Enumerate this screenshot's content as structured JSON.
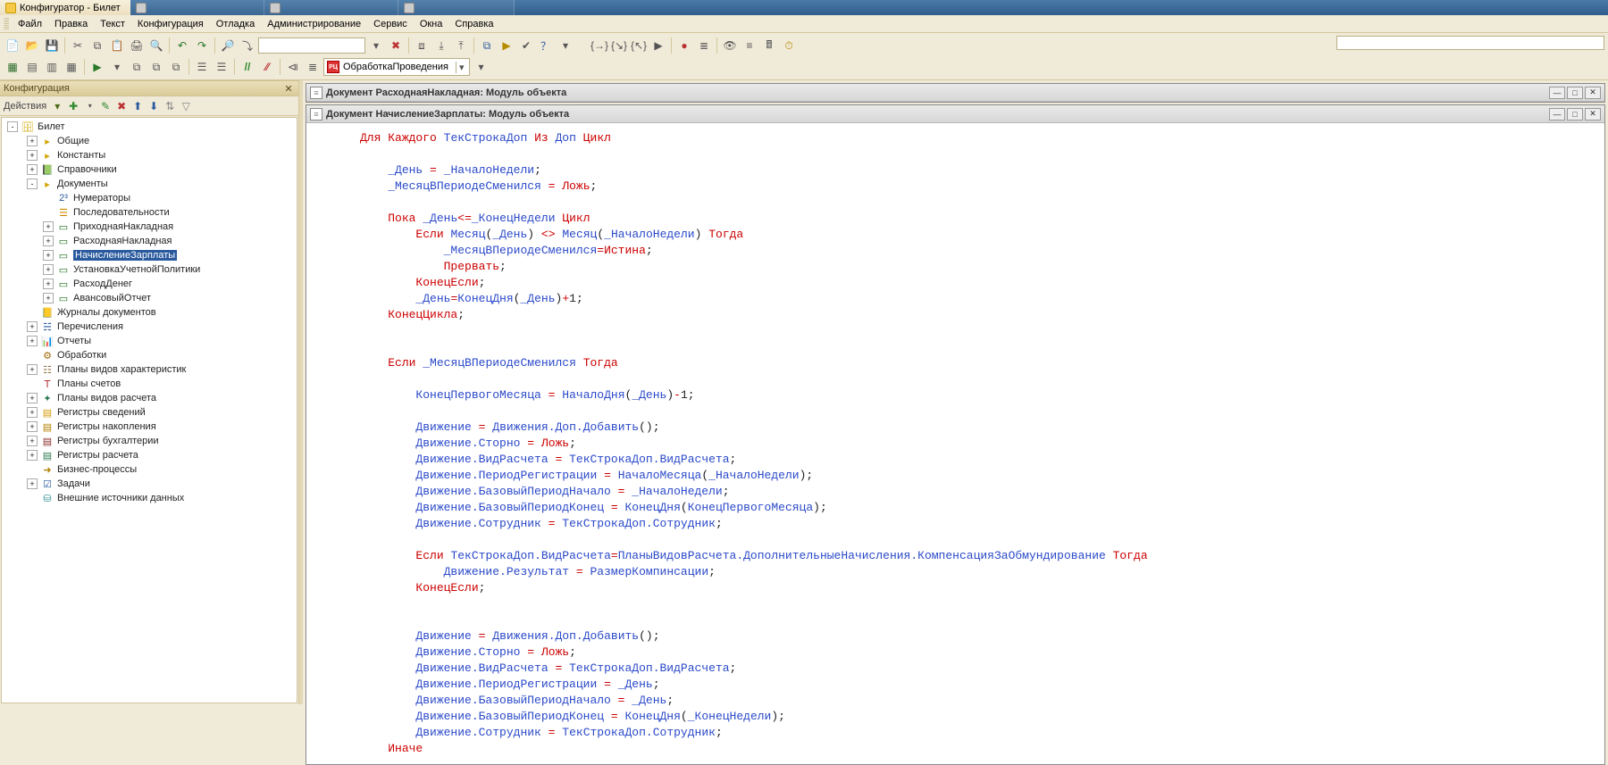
{
  "os_tabs": [
    {
      "label": "Конфигуратор - Билет",
      "active": true
    },
    {
      "label": "",
      "active": false
    },
    {
      "label": "",
      "active": false
    },
    {
      "label": "",
      "active": false
    }
  ],
  "menu": [
    "Файл",
    "Правка",
    "Текст",
    "Конфигурация",
    "Отладка",
    "Администрирование",
    "Сервис",
    "Окна",
    "Справка"
  ],
  "module_select": "ОбработкаПроведения",
  "panel_title": "Конфигурация",
  "panel_actions_label": "Действия",
  "tree": [
    {
      "lvl": 0,
      "exp": "-",
      "ico": "db",
      "label": "Билет",
      "sel": false
    },
    {
      "lvl": 1,
      "exp": "+",
      "ico": "folder",
      "label": "Общие"
    },
    {
      "lvl": 1,
      "exp": "+",
      "ico": "folder",
      "label": "Константы"
    },
    {
      "lvl": 1,
      "exp": "+",
      "ico": "book",
      "label": "Справочники"
    },
    {
      "lvl": 1,
      "exp": "-",
      "ico": "folder",
      "label": "Документы"
    },
    {
      "lvl": 2,
      "exp": " ",
      "ico": "num",
      "label": "Нумераторы"
    },
    {
      "lvl": 2,
      "exp": " ",
      "ico": "seq",
      "label": "Последовательности"
    },
    {
      "lvl": 2,
      "exp": "+",
      "ico": "doc",
      "label": "ПриходнаяНакладная"
    },
    {
      "lvl": 2,
      "exp": "+",
      "ico": "doc",
      "label": "РасходнаяНакладная"
    },
    {
      "lvl": 2,
      "exp": "+",
      "ico": "doc",
      "label": "НачислениеЗарплаты",
      "sel": true
    },
    {
      "lvl": 2,
      "exp": "+",
      "ico": "doc",
      "label": "УстановкаУчетнойПолитики"
    },
    {
      "lvl": 2,
      "exp": "+",
      "ico": "doc",
      "label": "РасходДенег"
    },
    {
      "lvl": 2,
      "exp": "+",
      "ico": "doc",
      "label": "АвансовыйОтчет"
    },
    {
      "lvl": 1,
      "exp": " ",
      "ico": "jour",
      "label": "Журналы документов"
    },
    {
      "lvl": 1,
      "exp": "+",
      "ico": "enum",
      "label": "Перечисления"
    },
    {
      "lvl": 1,
      "exp": "+",
      "ico": "rep",
      "label": "Отчеты"
    },
    {
      "lvl": 1,
      "exp": " ",
      "ico": "proc",
      "label": "Обработки"
    },
    {
      "lvl": 1,
      "exp": "+",
      "ico": "char",
      "label": "Планы видов характеристик"
    },
    {
      "lvl": 1,
      "exp": " ",
      "ico": "acct",
      "label": "Планы счетов"
    },
    {
      "lvl": 1,
      "exp": "+",
      "ico": "calc",
      "label": "Планы видов расчета"
    },
    {
      "lvl": 1,
      "exp": "+",
      "ico": "reginf",
      "label": "Регистры сведений"
    },
    {
      "lvl": 1,
      "exp": "+",
      "ico": "regaccum",
      "label": "Регистры накопления"
    },
    {
      "lvl": 1,
      "exp": "+",
      "ico": "regacc",
      "label": "Регистры бухгалтерии"
    },
    {
      "lvl": 1,
      "exp": "+",
      "ico": "regcalc",
      "label": "Регистры расчета"
    },
    {
      "lvl": 1,
      "exp": " ",
      "ico": "bp",
      "label": "Бизнес-процессы"
    },
    {
      "lvl": 1,
      "exp": "+",
      "ico": "task",
      "label": "Задачи"
    },
    {
      "lvl": 1,
      "exp": " ",
      "ico": "ext",
      "label": "Внешние источники данных"
    }
  ],
  "doc_tabs": [
    "Документ РасходнаяНакладная: Модуль объекта",
    "Документ НачислениеЗарплаты: Модуль объекта"
  ],
  "code_lines": [
    [
      [
        "kw",
        "Для"
      ],
      [
        "sp",
        " "
      ],
      [
        "kw",
        "Каждого"
      ],
      [
        "sp",
        " "
      ],
      [
        "id",
        "ТекСтрокаДоп"
      ],
      [
        "sp",
        " "
      ],
      [
        "kw",
        "Из"
      ],
      [
        "sp",
        " "
      ],
      [
        "id",
        "Доп"
      ],
      [
        "sp",
        " "
      ],
      [
        "kw",
        "Цикл"
      ]
    ],
    [],
    [
      [
        "sp",
        "    "
      ],
      [
        "id",
        "_День"
      ],
      [
        "sp",
        " "
      ],
      [
        "eq",
        "="
      ],
      [
        "sp",
        " "
      ],
      [
        "id",
        "_НачалоНедели"
      ],
      [
        "pr",
        ";"
      ]
    ],
    [
      [
        "sp",
        "    "
      ],
      [
        "id",
        "_МесяцВПериодеСменился"
      ],
      [
        "sp",
        " "
      ],
      [
        "eq",
        "="
      ],
      [
        "sp",
        " "
      ],
      [
        "kw",
        "Ложь"
      ],
      [
        "pr",
        ";"
      ]
    ],
    [],
    [
      [
        "sp",
        "    "
      ],
      [
        "kw",
        "Пока"
      ],
      [
        "sp",
        " "
      ],
      [
        "id",
        "_День"
      ],
      [
        "op",
        "<="
      ],
      [
        "id",
        "_КонецНедели"
      ],
      [
        "sp",
        " "
      ],
      [
        "kw",
        "Цикл"
      ]
    ],
    [
      [
        "sp",
        "        "
      ],
      [
        "kw",
        "Если"
      ],
      [
        "sp",
        " "
      ],
      [
        "id",
        "Месяц"
      ],
      [
        "pr",
        "("
      ],
      [
        "id",
        "_День"
      ],
      [
        "pr",
        ")"
      ],
      [
        "sp",
        " "
      ],
      [
        "op",
        "<>"
      ],
      [
        "sp",
        " "
      ],
      [
        "id",
        "Месяц"
      ],
      [
        "pr",
        "("
      ],
      [
        "id",
        "_НачалоНедели"
      ],
      [
        "pr",
        ")"
      ],
      [
        "sp",
        " "
      ],
      [
        "kw",
        "Тогда"
      ]
    ],
    [
      [
        "sp",
        "            "
      ],
      [
        "id",
        "_МесяцВПериодеСменился"
      ],
      [
        "eq",
        "="
      ],
      [
        "kw",
        "Истина"
      ],
      [
        "pr",
        ";"
      ]
    ],
    [
      [
        "sp",
        "            "
      ],
      [
        "kw",
        "Прервать"
      ],
      [
        "pr",
        ";"
      ]
    ],
    [
      [
        "sp",
        "        "
      ],
      [
        "kw",
        "КонецЕсли"
      ],
      [
        "pr",
        ";"
      ]
    ],
    [
      [
        "sp",
        "        "
      ],
      [
        "id",
        "_День"
      ],
      [
        "eq",
        "="
      ],
      [
        "id",
        "КонецДня"
      ],
      [
        "pr",
        "("
      ],
      [
        "id",
        "_День"
      ],
      [
        "pr",
        ")"
      ],
      [
        "op",
        "+"
      ],
      [
        "nr",
        "1"
      ],
      [
        "pr",
        ";"
      ]
    ],
    [
      [
        "sp",
        "    "
      ],
      [
        "kw",
        "КонецЦикла"
      ],
      [
        "pr",
        ";"
      ]
    ],
    [],
    [],
    [
      [
        "sp",
        "    "
      ],
      [
        "kw",
        "Если"
      ],
      [
        "sp",
        " "
      ],
      [
        "id",
        "_МесяцВПериодеСменился"
      ],
      [
        "sp",
        " "
      ],
      [
        "kw",
        "Тогда"
      ]
    ],
    [],
    [
      [
        "sp",
        "        "
      ],
      [
        "id",
        "КонецПервогоМесяца"
      ],
      [
        "sp",
        " "
      ],
      [
        "eq",
        "="
      ],
      [
        "sp",
        " "
      ],
      [
        "id",
        "НачалоДня"
      ],
      [
        "pr",
        "("
      ],
      [
        "id",
        "_День"
      ],
      [
        "pr",
        ")"
      ],
      [
        "op",
        "-"
      ],
      [
        "nr",
        "1"
      ],
      [
        "pr",
        ";"
      ]
    ],
    [],
    [
      [
        "sp",
        "        "
      ],
      [
        "id",
        "Движение"
      ],
      [
        "sp",
        " "
      ],
      [
        "eq",
        "="
      ],
      [
        "sp",
        " "
      ],
      [
        "id",
        "Движения.Доп.Добавить"
      ],
      [
        "pr",
        "();"
      ]
    ],
    [
      [
        "sp",
        "        "
      ],
      [
        "id",
        "Движение.Сторно"
      ],
      [
        "sp",
        " "
      ],
      [
        "eq",
        "="
      ],
      [
        "sp",
        " "
      ],
      [
        "kw",
        "Ложь"
      ],
      [
        "pr",
        ";"
      ]
    ],
    [
      [
        "sp",
        "        "
      ],
      [
        "id",
        "Движение.ВидРасчета"
      ],
      [
        "sp",
        " "
      ],
      [
        "eq",
        "="
      ],
      [
        "sp",
        " "
      ],
      [
        "id",
        "ТекСтрокаДоп.ВидРасчета"
      ],
      [
        "pr",
        ";"
      ]
    ],
    [
      [
        "sp",
        "        "
      ],
      [
        "id",
        "Движение.ПериодРегистрации"
      ],
      [
        "sp",
        " "
      ],
      [
        "eq",
        "="
      ],
      [
        "sp",
        " "
      ],
      [
        "id",
        "НачалоМесяца"
      ],
      [
        "pr",
        "("
      ],
      [
        "id",
        "_НачалоНедели"
      ],
      [
        "pr",
        ");"
      ]
    ],
    [
      [
        "sp",
        "        "
      ],
      [
        "id",
        "Движение.БазовыйПериодНачало"
      ],
      [
        "sp",
        " "
      ],
      [
        "eq",
        "="
      ],
      [
        "sp",
        " "
      ],
      [
        "id",
        "_НачалоНедели"
      ],
      [
        "pr",
        ";"
      ]
    ],
    [
      [
        "sp",
        "        "
      ],
      [
        "id",
        "Движение.БазовыйПериодКонец"
      ],
      [
        "sp",
        " "
      ],
      [
        "eq",
        "="
      ],
      [
        "sp",
        " "
      ],
      [
        "id",
        "КонецДня"
      ],
      [
        "pr",
        "("
      ],
      [
        "id",
        "КонецПервогоМесяца"
      ],
      [
        "pr",
        ");"
      ]
    ],
    [
      [
        "sp",
        "        "
      ],
      [
        "id",
        "Движение.Сотрудник"
      ],
      [
        "sp",
        " "
      ],
      [
        "eq",
        "="
      ],
      [
        "sp",
        " "
      ],
      [
        "id",
        "ТекСтрокаДоп.Сотрудник"
      ],
      [
        "pr",
        ";"
      ]
    ],
    [],
    [
      [
        "sp",
        "        "
      ],
      [
        "kw",
        "Если"
      ],
      [
        "sp",
        " "
      ],
      [
        "id",
        "ТекСтрокаДоп.ВидРасчета"
      ],
      [
        "eq",
        "="
      ],
      [
        "id",
        "ПланыВидовРасчета.ДополнительныеНачисления.КомпенсацияЗаОбмундирование"
      ],
      [
        "sp",
        " "
      ],
      [
        "kw",
        "Тогда"
      ]
    ],
    [
      [
        "sp",
        "            "
      ],
      [
        "id",
        "Движение.Результат"
      ],
      [
        "sp",
        " "
      ],
      [
        "eq",
        "="
      ],
      [
        "sp",
        " "
      ],
      [
        "id",
        "РазмерКомпинсации"
      ],
      [
        "pr",
        ";"
      ]
    ],
    [
      [
        "sp",
        "        "
      ],
      [
        "kw",
        "КонецЕсли"
      ],
      [
        "pr",
        ";"
      ]
    ],
    [],
    [],
    [
      [
        "sp",
        "        "
      ],
      [
        "id",
        "Движение"
      ],
      [
        "sp",
        " "
      ],
      [
        "eq",
        "="
      ],
      [
        "sp",
        " "
      ],
      [
        "id",
        "Движения.Доп.Добавить"
      ],
      [
        "pr",
        "();"
      ]
    ],
    [
      [
        "sp",
        "        "
      ],
      [
        "id",
        "Движение.Сторно"
      ],
      [
        "sp",
        " "
      ],
      [
        "eq",
        "="
      ],
      [
        "sp",
        " "
      ],
      [
        "kw",
        "Ложь"
      ],
      [
        "pr",
        ";"
      ]
    ],
    [
      [
        "sp",
        "        "
      ],
      [
        "id",
        "Движение.ВидРасчета"
      ],
      [
        "sp",
        " "
      ],
      [
        "eq",
        "="
      ],
      [
        "sp",
        " "
      ],
      [
        "id",
        "ТекСтрокаДоп.ВидРасчета"
      ],
      [
        "pr",
        ";"
      ]
    ],
    [
      [
        "sp",
        "        "
      ],
      [
        "id",
        "Движение.ПериодРегистрации"
      ],
      [
        "sp",
        " "
      ],
      [
        "eq",
        "="
      ],
      [
        "sp",
        " "
      ],
      [
        "id",
        "_День"
      ],
      [
        "pr",
        ";"
      ]
    ],
    [
      [
        "sp",
        "        "
      ],
      [
        "id",
        "Движение.БазовыйПериодНачало"
      ],
      [
        "sp",
        " "
      ],
      [
        "eq",
        "="
      ],
      [
        "sp",
        " "
      ],
      [
        "id",
        "_День"
      ],
      [
        "pr",
        ";"
      ]
    ],
    [
      [
        "sp",
        "        "
      ],
      [
        "id",
        "Движение.БазовыйПериодКонец"
      ],
      [
        "sp",
        " "
      ],
      [
        "eq",
        "="
      ],
      [
        "sp",
        " "
      ],
      [
        "id",
        "КонецДня"
      ],
      [
        "pr",
        "("
      ],
      [
        "id",
        "_КонецНедели"
      ],
      [
        "pr",
        ");"
      ]
    ],
    [
      [
        "sp",
        "        "
      ],
      [
        "id",
        "Движение.Сотрудник"
      ],
      [
        "sp",
        " "
      ],
      [
        "eq",
        "="
      ],
      [
        "sp",
        " "
      ],
      [
        "id",
        "ТекСтрокаДоп.Сотрудник"
      ],
      [
        "pr",
        ";"
      ]
    ],
    [
      [
        "sp",
        "    "
      ],
      [
        "kw",
        "Иначе"
      ]
    ]
  ]
}
